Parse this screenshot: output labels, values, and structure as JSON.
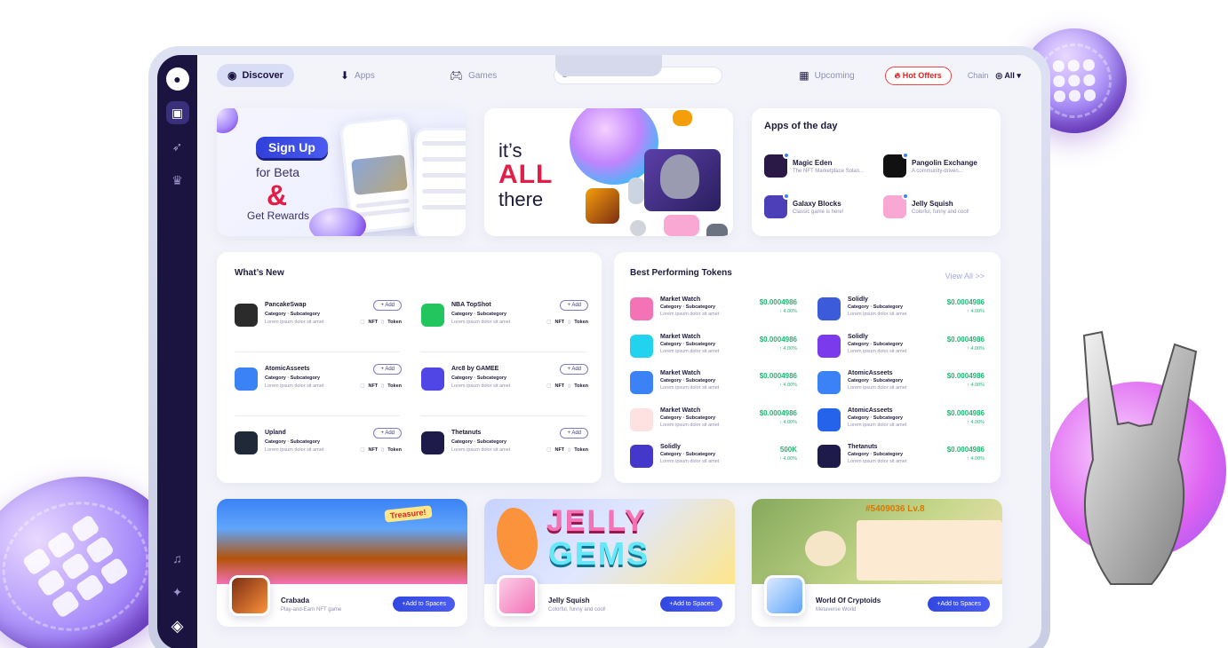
{
  "nav": {
    "discover": "Discover",
    "apps": "Apps",
    "games": "Games",
    "upcoming": "Upcoming",
    "hot_offers": "Hot Offers",
    "chain_label": "Chain",
    "chain_value": "All ▾"
  },
  "search": {
    "placeholder": ""
  },
  "hero_signup": {
    "button": "Sign Up",
    "line1": "for Beta",
    "amp": "&",
    "line2": "Get Rewards"
  },
  "hero_all": {
    "line1": "it’s",
    "line2": "ALL",
    "line3": "there"
  },
  "apps_of_day": {
    "title": "Apps of the day",
    "items": [
      {
        "name": "Magic Eden",
        "desc": "The NFT Marketplace Solan...",
        "color": "#2a1846"
      },
      {
        "name": "Pangolin Exchange",
        "desc": "A community-driven...",
        "color": "#f59e0b"
      },
      {
        "name": "Galaxy Blocks",
        "desc": "Classic game is here!",
        "color": "#4c3fb8"
      },
      {
        "name": "Jelly Squish",
        "desc": "Colorful, funny and cool!",
        "color": "#f9a8d4"
      }
    ]
  },
  "whats_new": {
    "title": "What’s New",
    "add_label": "+ Add",
    "tag_nft": "NFT",
    "tag_token": "Token",
    "items": [
      {
        "name": "PancakeSwap",
        "cat": "Category · Subcategory",
        "desc": "Lorem ipsum dolor sit amet",
        "color": "#2b2b2b"
      },
      {
        "name": "NBA TopShot",
        "cat": "Category · Subcategory",
        "desc": "Lorem ipsum dolor sit amet",
        "color": "#22c55e"
      },
      {
        "name": "AtomicAsseets",
        "cat": "Category · Subcategory",
        "desc": "Lorem ipsum dolor sit amet",
        "color": "#3b82f6"
      },
      {
        "name": "Arc8 by GAMEE",
        "cat": "Category · Subcategory",
        "desc": "Lorem ipsum dolor sit amet",
        "color": "#4f46e5"
      },
      {
        "name": "Upland",
        "cat": "Category · Subcategory",
        "desc": "Lorem ipsum dolor sit amet",
        "color": "#1f2937"
      },
      {
        "name": "Thetanuts",
        "cat": "Category · Subcategory",
        "desc": "Lorem ipsum dolor sit amet",
        "color": "#1e1b4b"
      }
    ]
  },
  "tokens": {
    "title": "Best Performing Tokens",
    "view_all": "View All >>",
    "items": [
      {
        "name": "Market Watch",
        "cat": "Category · Subcategory",
        "desc": "Lorem ipsum dolor sit amet",
        "price": "$0.0004986",
        "change": "↑ 4.00%",
        "color": "#f472b6"
      },
      {
        "name": "Solidly",
        "cat": "Category · Subcategory",
        "desc": "Lorem ipsum dolor sit amet",
        "price": "$0.0004986",
        "change": "↑ 4.00%",
        "color": "#3b5bdb"
      },
      {
        "name": "Market Watch",
        "cat": "Category · Subcategory",
        "desc": "Lorem ipsum dolor sit amet",
        "price": "$0.0004986",
        "change": "↑ 4.00%",
        "color": "#22d3ee"
      },
      {
        "name": "Solidly",
        "cat": "Category · Subcategory",
        "desc": "Lorem ipsum dolor sit amet",
        "price": "$0.0004986",
        "change": "↑ 4.00%",
        "color": "#7c3aed"
      },
      {
        "name": "Market Watch",
        "cat": "Category · Subcategory",
        "desc": "Lorem ipsum dolor sit amet",
        "price": "$0.0004986",
        "change": "↑ 4.00%",
        "color": "#3b82f6"
      },
      {
        "name": "AtomicAsseets",
        "cat": "Category · Subcategory",
        "desc": "Lorem ipsum dolor sit amet",
        "price": "$0.0004986",
        "change": "↑ 4.00%",
        "color": "#3b82f6"
      },
      {
        "name": "Market Watch",
        "cat": "Category · Subcategory",
        "desc": "Lorem ipsum dolor sit amet",
        "price": "$0.0004986",
        "change": "↑ 4.00%",
        "color": "#fee2e2"
      },
      {
        "name": "AtomicAsseets",
        "cat": "Category · Subcategory",
        "desc": "Lorem ipsum dolor sit amet",
        "price": "$0.0004986",
        "change": "↑ 4.00%",
        "color": "#2563eb"
      },
      {
        "name": "Solidly",
        "cat": "Category · Subcategory",
        "desc": "Lorem ipsum dolor sit amet",
        "price": "500K",
        "change": "↑ 4.00%",
        "color": "#4338ca"
      },
      {
        "name": "Thetanuts",
        "cat": "Category · Subcategory",
        "desc": "Lorem ipsum dolor sit amet",
        "price": "$0.0004986",
        "change": "↑ 4.00%",
        "color": "#1e1b4b"
      }
    ]
  },
  "games": {
    "add_label": "+Add to Spaces",
    "items": [
      {
        "name": "Crabada",
        "desc": "Play-and-Earn NFT game",
        "banner_text": "Treasure!"
      },
      {
        "name": "Jelly Squish",
        "desc": "Colorful, funny and cool!",
        "banner_text1": "JELLY",
        "banner_text2": "GEMS"
      },
      {
        "name": "World Of Cryptoids",
        "desc": "Metaverse World",
        "banner_text": "#5409036 Lv.8"
      }
    ]
  }
}
